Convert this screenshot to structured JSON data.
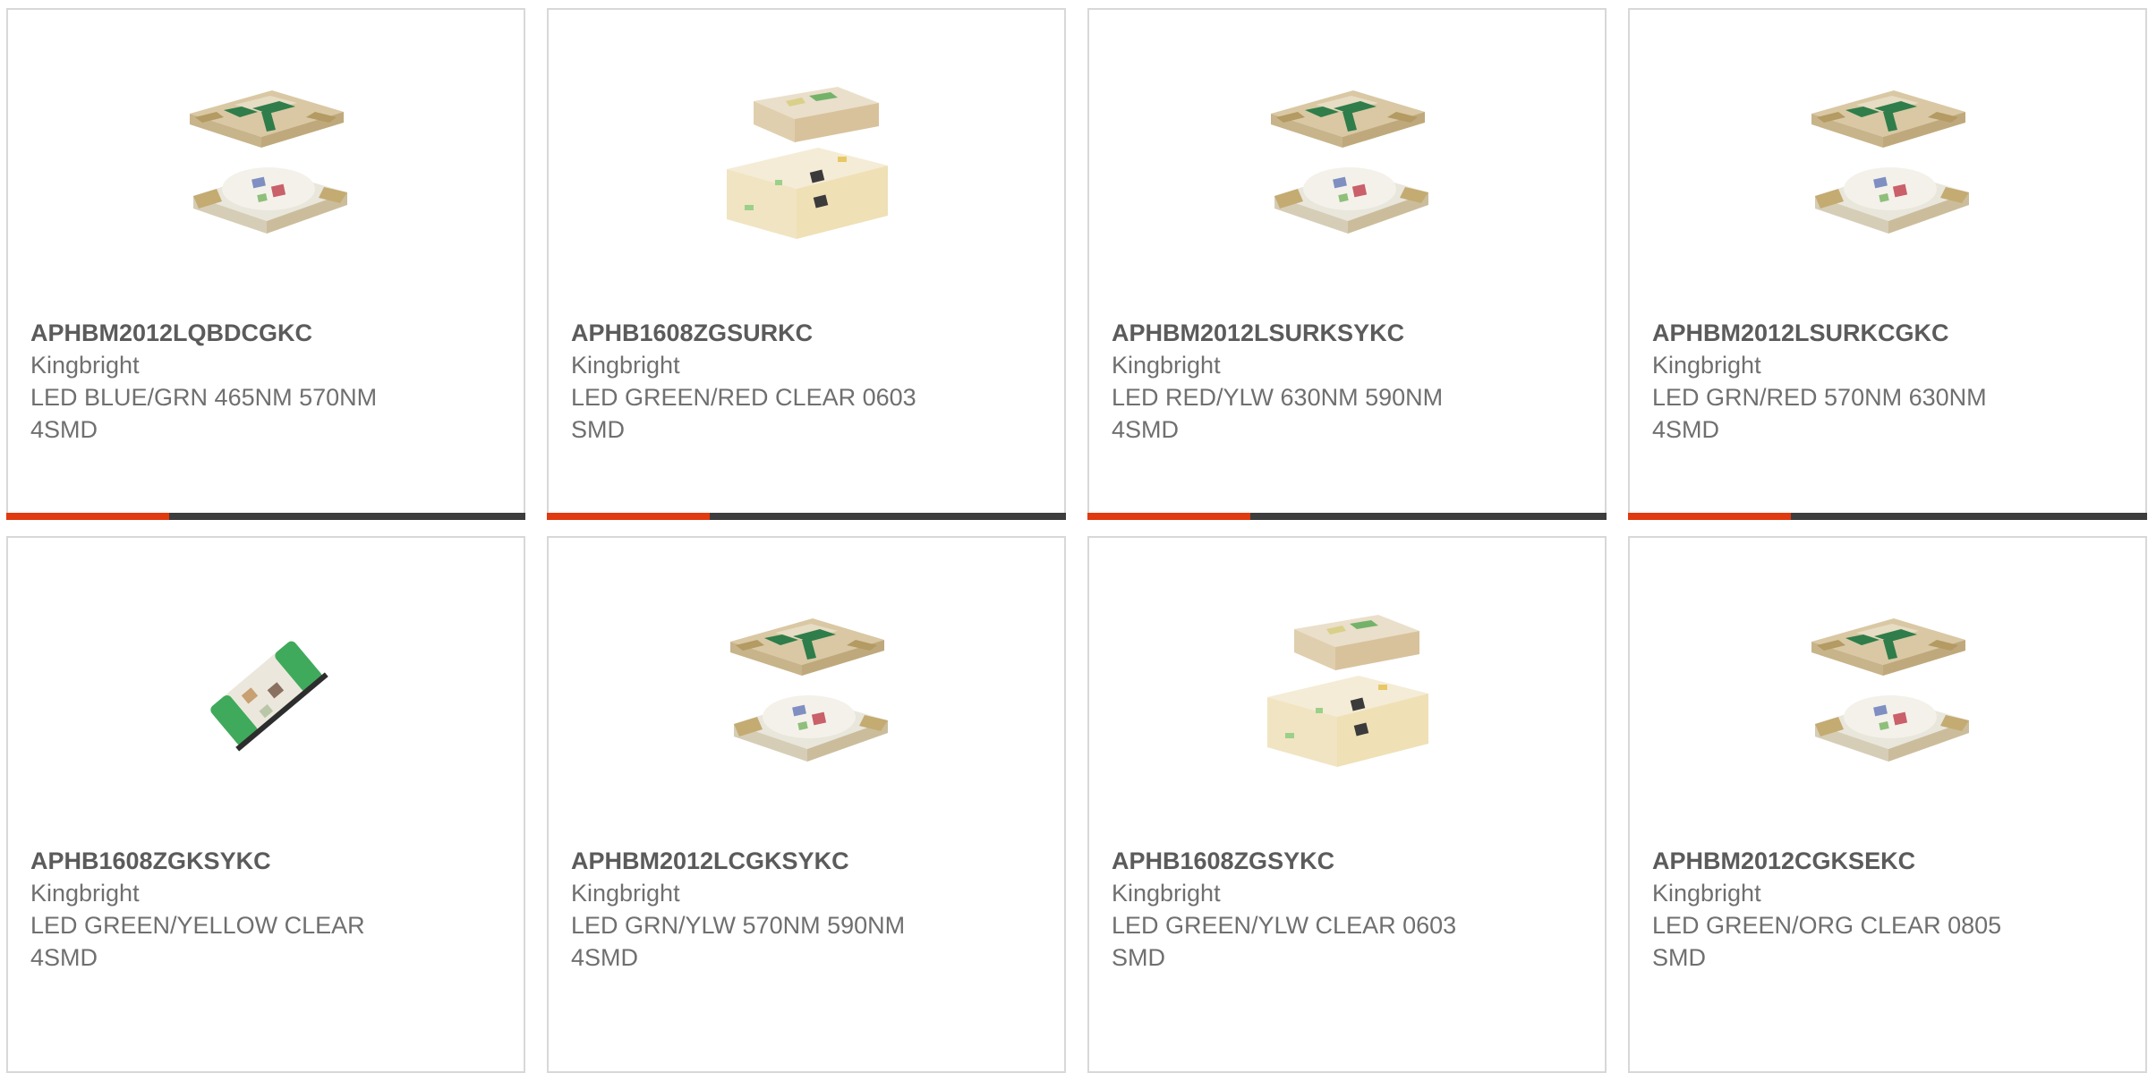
{
  "colors": {
    "accent_red": "#e03a10",
    "bar_dark": "#3d3d3d",
    "border": "#d8d8d8"
  },
  "products": [
    {
      "part_number": "APHBM2012LQBDCGKC",
      "manufacturer": "Kingbright",
      "description": "LED BLUE/GRN 465NM 570NM\n4SMD",
      "image_icon": "led-stack-icon"
    },
    {
      "part_number": "APHB1608ZGSURKC",
      "manufacturer": "Kingbright",
      "description": "LED GREEN/RED CLEAR 0603\nSMD",
      "image_icon": "led-block-icon"
    },
    {
      "part_number": "APHBM2012LSURKSYKC",
      "manufacturer": "Kingbright",
      "description": "LED RED/YLW 630NM 590NM\n4SMD",
      "image_icon": "led-stack-icon"
    },
    {
      "part_number": "APHBM2012LSURKCGKC",
      "manufacturer": "Kingbright",
      "description": "LED GRN/RED 570NM 630NM\n4SMD",
      "image_icon": "led-stack-icon"
    },
    {
      "part_number": "APHB1608ZGKSYKC",
      "manufacturer": "Kingbright",
      "description": "LED GREEN/YELLOW CLEAR\n4SMD",
      "image_icon": "led-tilted-chip-icon"
    },
    {
      "part_number": "APHBM2012LCGKSYKC",
      "manufacturer": "Kingbright",
      "description": "LED GRN/YLW 570NM 590NM\n4SMD",
      "image_icon": "led-stack-icon"
    },
    {
      "part_number": "APHB1608ZGSYKC",
      "manufacturer": "Kingbright",
      "description": "LED GREEN/YLW CLEAR 0603\nSMD",
      "image_icon": "led-block-icon"
    },
    {
      "part_number": "APHBM2012CGKSEKC",
      "manufacturer": "Kingbright",
      "description": "LED GREEN/ORG CLEAR 0805\nSMD",
      "image_icon": "led-stack-icon"
    }
  ]
}
